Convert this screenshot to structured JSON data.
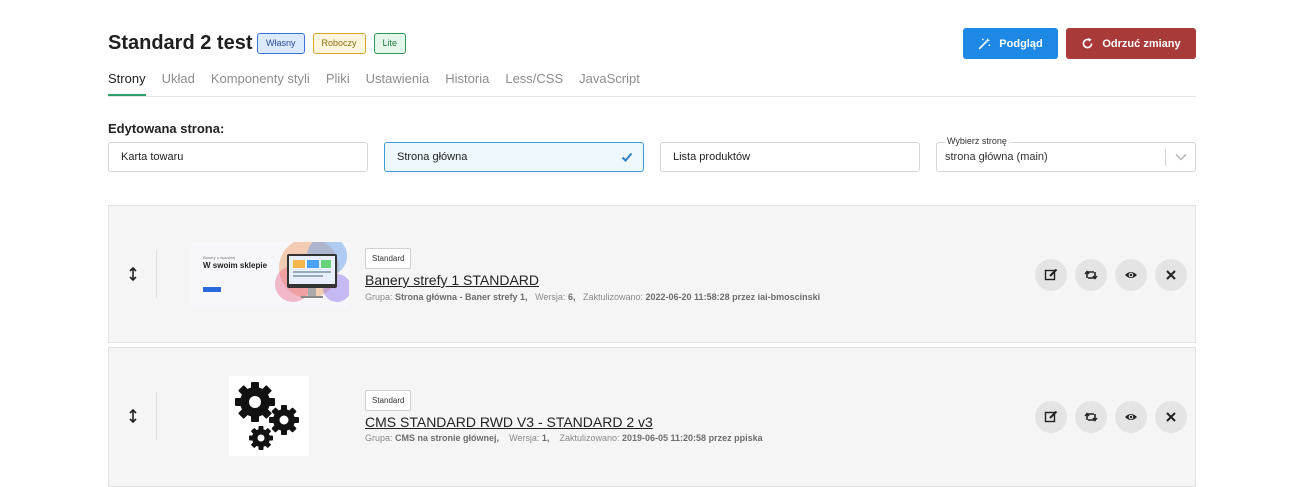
{
  "header": {
    "title": "Standard 2 test",
    "badges": [
      "Własny",
      "Roboczy",
      "Lite"
    ],
    "preview_label": "Podgląd",
    "reject_label": "Odrzuć zmiany"
  },
  "tabs": [
    "Strony",
    "Układ",
    "Komponenty styli",
    "Pliki",
    "Ustawienia",
    "Historia",
    "Less/CSS",
    "JavaScript"
  ],
  "edited_page": {
    "label": "Edytowana strona:",
    "options": [
      "Karta towaru",
      "Strona główna",
      "Lista produktów"
    ],
    "selected": "Strona główna",
    "select_label": "Wybierz stronę",
    "select_value": "strona główna (main)"
  },
  "modules": [
    {
      "badge": "Standard",
      "name": "Banery strefy 1 STANDARD",
      "group_label": "Grupa:",
      "group": "Strona główna - Baner strefy 1,",
      "version_label": "Wersja:",
      "version": "6,",
      "updated_label": "Zaktulizowano:",
      "updated": "2022-06-20 11:58:28 przez iai-bmoscinski",
      "thumb_small": "Banery o wysokiej",
      "thumb_title": "W swoim sklepie"
    },
    {
      "badge": "Standard",
      "name": "CMS STANDARD RWD V3 - STANDARD 2 v3",
      "group_label": "Grupa:",
      "group": "CMS na stronie głównej,",
      "version_label": "Wersja:",
      "version": "1,",
      "updated_label": "Zaktulizowano:",
      "updated": "2019-06-05 11:20:58 przez ppiska"
    }
  ],
  "colors": {
    "accent_blue": "#1e88e5",
    "danger": "#a83a3a",
    "tab_active": "#2e9e6b"
  }
}
